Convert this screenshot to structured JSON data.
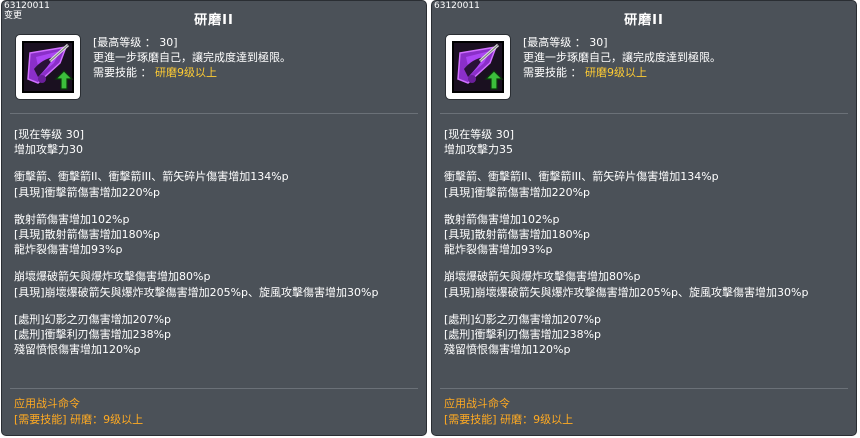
{
  "panels": [
    {
      "id_text": "63120011",
      "sub_text": "变更",
      "title": "研磨II",
      "header": {
        "max_level": "[最高等级 ： 30]",
        "desc": "更進一步琢磨自己，讓完成度達到極限。",
        "required_label": "需要技能 ：",
        "required_value": "研磨9级以上"
      },
      "current_level": "[现在等级 30]",
      "attack_bonus": "增加攻擊力30",
      "lines": [
        "衝擊箭、衝擊箭II、衝擊箭III、箭矢碎片傷害增加134%p",
        "[具現]衝擊箭傷害增加220%p",
        "散射箭傷害增加102%p",
        "[具現]散射箭傷害增加180%p",
        "龍炸裂傷害增加93%p",
        "崩壞爆破箭矢與爆炸攻擊傷害增加80%p",
        "[具現]崩壞爆破箭矢與爆炸攻擊傷害增加205%p、旋風攻擊傷害增加30%p",
        "[處刑]幻影之刃傷害增加207%p",
        "[處刑]衝擊利刃傷害增加238%p",
        "殘留憤恨傷害增加120%p"
      ],
      "footer": {
        "apply": "应用战斗命令",
        "req": "[需要技能] 研磨：9级以上"
      }
    },
    {
      "id_text": "63120011",
      "sub_text": "",
      "title": "研磨II",
      "header": {
        "max_level": "[最高等级 ： 30]",
        "desc": "更進一步琢磨自己，讓完成度達到極限。",
        "required_label": "需要技能 ：",
        "required_value": "研磨9级以上"
      },
      "current_level": "[现在等级 30]",
      "attack_bonus": "增加攻擊力35",
      "lines": [
        "衝擊箭、衝擊箭II、衝擊箭III、箭矢碎片傷害增加134%p",
        "[具現]衝擊箭傷害增加220%p",
        "散射箭傷害增加102%p",
        "[具現]散射箭傷害增加180%p",
        "龍炸裂傷害增加93%p",
        "崩壞爆破箭矢與爆炸攻擊傷害增加80%p",
        "[具現]崩壞爆破箭矢與爆炸攻擊傷害增加205%p、旋風攻擊傷害增加30%p",
        "[處刑]幻影之刃傷害增加207%p",
        "[處刑]衝擊利刃傷害增加238%p",
        "殘留憤恨傷害增加120%p"
      ],
      "footer": {
        "apply": "应用战斗命令",
        "req": "[需要技能] 研磨：9级以上"
      }
    }
  ],
  "icon": "skill-icon-purple-blade-green-arrow",
  "colors": {
    "panel_bg": "#4b5158",
    "text": "#ffffff",
    "required_skill": "#ffcc33",
    "footer_text": "#ffaa22",
    "separator": "#6b7178",
    "icon_purple": "#8b2fc9",
    "icon_arrow": "#3cbf3c"
  }
}
